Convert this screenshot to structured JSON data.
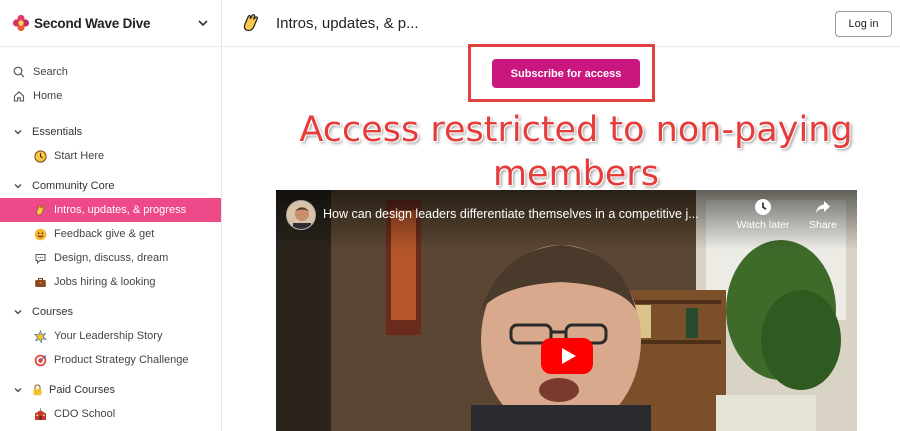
{
  "brand": {
    "name": "Second Wave Dive"
  },
  "sidebar": {
    "top_items": [
      {
        "label": "Search",
        "icon": "search-icon"
      },
      {
        "label": "Home",
        "icon": "home-icon"
      }
    ],
    "sections": [
      {
        "label": "Essentials"
      },
      {
        "label": "Community Core"
      },
      {
        "label": "Courses"
      },
      {
        "label": "Paid Courses"
      }
    ],
    "items": [
      {
        "label": "Start Here",
        "icon": "clock-icon"
      },
      {
        "label": "Intros, updates, & progress",
        "icon": "waving-hand-icon",
        "active": true
      },
      {
        "label": "Feedback give & get",
        "icon": "smiley-icon"
      },
      {
        "label": "Design, discuss, dream",
        "icon": "speech-bubble-icon"
      },
      {
        "label": "Jobs hiring & looking",
        "icon": "briefcase-icon"
      },
      {
        "label": "Your Leadership Story",
        "icon": "star-burst-icon"
      },
      {
        "label": "Product Strategy Challenge",
        "icon": "target-icon"
      },
      {
        "label": "CDO School",
        "icon": "school-icon"
      }
    ]
  },
  "header": {
    "title": "Intros, updates, & p...",
    "login_label": "Log in"
  },
  "main": {
    "subscribe_label": "Subscribe for access",
    "annotation": "Access restricted to non-paying members"
  },
  "video": {
    "title": "How can design leaders differentiate themselves in a competitive j...",
    "watch_later_label": "Watch later",
    "share_label": "Share"
  },
  "colors": {
    "accent": "#ee4a8a",
    "subscribe": "#c9177f",
    "annotation": "#e43d3c",
    "youtube_red": "#ff0000"
  }
}
